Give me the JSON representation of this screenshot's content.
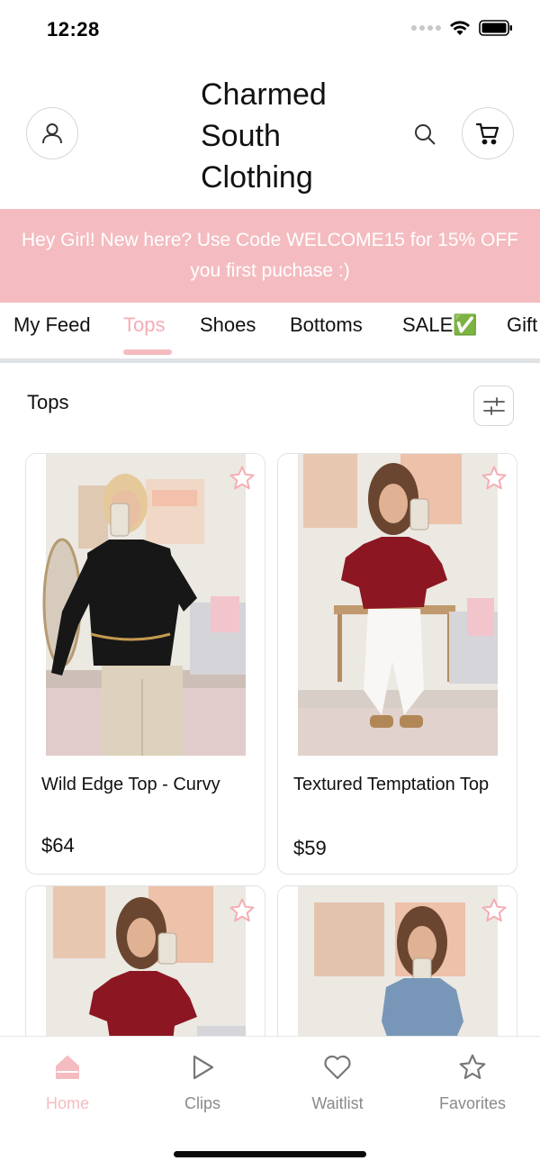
{
  "status": {
    "time": "12:28"
  },
  "header": {
    "brand": "Charmed South Clothing"
  },
  "promo": {
    "text": "Hey Girl! New here? Use Code WELCOME15 for 15% OFF you first puchase :)"
  },
  "tabs": [
    {
      "label": "My Feed"
    },
    {
      "label": "Tops"
    },
    {
      "label": "Shoes"
    },
    {
      "label": "Bottoms"
    },
    {
      "label": "SALE✅"
    },
    {
      "label": "Gift"
    }
  ],
  "section": {
    "title": "Tops"
  },
  "products": [
    {
      "name": "Wild Edge Top - Curvy",
      "price": "$64"
    },
    {
      "name": "Textured Temptation Top",
      "price": "$59"
    },
    {
      "name": "",
      "price": ""
    },
    {
      "name": "",
      "price": ""
    }
  ],
  "nav": [
    {
      "label": "Home"
    },
    {
      "label": "Clips"
    },
    {
      "label": "Waitlist"
    },
    {
      "label": "Favorites"
    }
  ],
  "colors": {
    "accent": "#f4bcc0",
    "active_tab": "#f4aeb5",
    "inactive_nav": "#8a8a8a"
  }
}
